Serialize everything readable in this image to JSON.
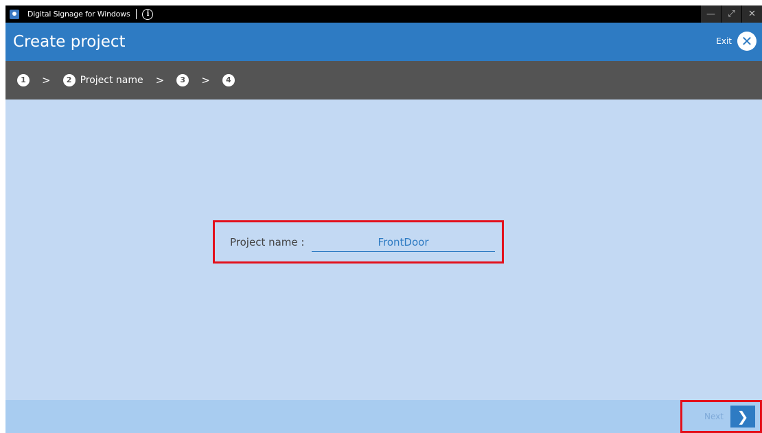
{
  "titlebar": {
    "app_title": "Digital Signage for Windows",
    "info_glyph": "i",
    "controls": {
      "minimize": "—",
      "maximize": "⤢",
      "close": "✕"
    }
  },
  "header": {
    "title": "Create project",
    "exit_label": "Exit",
    "exit_glyph": "✕"
  },
  "steps": [
    {
      "number": "1",
      "label": ""
    },
    {
      "number": "2",
      "label": "Project name"
    },
    {
      "number": "3",
      "label": ""
    },
    {
      "number": "4",
      "label": ""
    }
  ],
  "step_separator": ">",
  "form": {
    "label": "Project name :",
    "value": "FrontDoor"
  },
  "footer": {
    "next_label": "Next",
    "next_glyph": "❯"
  },
  "colors": {
    "header": "#2e7bc3",
    "stepbar": "#545454",
    "content": "#c3d9f3",
    "footer": "#a8ccf0",
    "highlight": "#e3101b"
  },
  "icons": {
    "app": "digital-signage-app-icon",
    "info": "info-icon",
    "exit": "close-circle-icon",
    "next": "chevron-right-icon"
  }
}
